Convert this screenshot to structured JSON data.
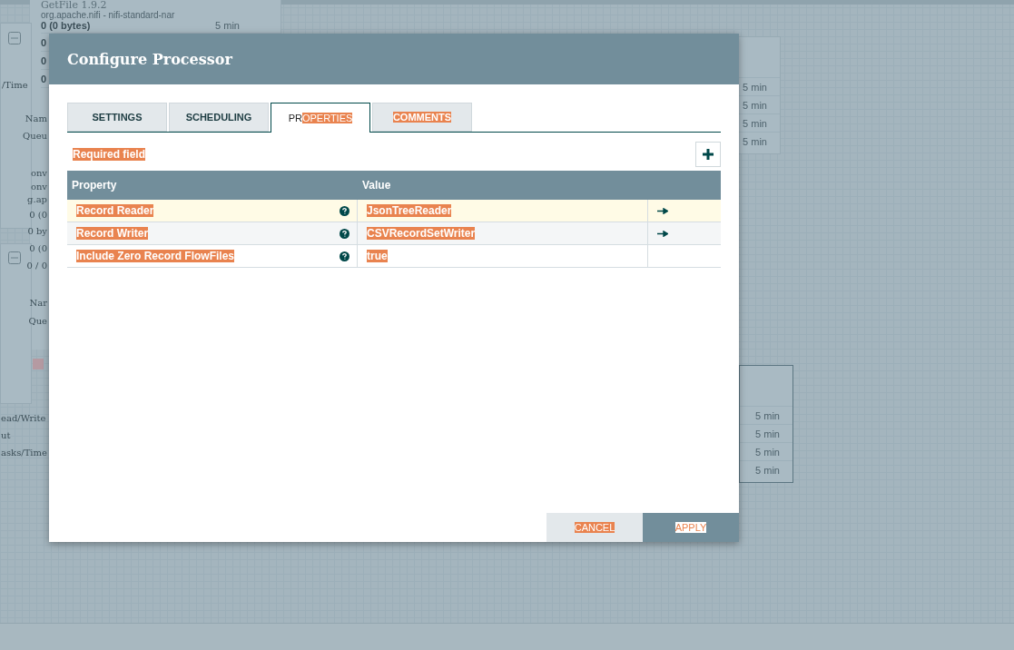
{
  "canvas": {
    "left_card": {
      "title": "GetFile 1.9.2",
      "bundle": "org.apache.nifi - nifi-standard-nar",
      "stats": [
        {
          "value": "0 (0 bytes)",
          "time": "5 min"
        },
        {
          "value": "0"
        },
        {
          "value": "0"
        },
        {
          "value": "0"
        }
      ]
    },
    "fragments": [
      "/Time",
      "Nam",
      "Queu",
      "onv",
      "onv",
      "g.ap",
      "0 (0",
      "0 by",
      "0 (0",
      "0 / 0",
      "Nar",
      "Que",
      "ead/Write",
      "ut",
      "asks/Time"
    ],
    "right_cards": [
      {
        "selected": false,
        "times": [
          "5 min",
          "5 min",
          "5 min",
          "5 min"
        ]
      },
      {
        "selected": true,
        "times": [
          "5 min",
          "5 min",
          "5 min",
          "5 min"
        ]
      }
    ]
  },
  "dialog": {
    "title": "Configure Processor",
    "tabs": [
      {
        "selected": false,
        "label": [
          {
            "text": "SETTINGS",
            "highlighted": false
          }
        ]
      },
      {
        "selected": false,
        "label": [
          {
            "text": "SCHEDULING",
            "highlighted": false
          }
        ]
      },
      {
        "selected": true,
        "label": [
          {
            "text": "PR",
            "highlighted": false
          },
          {
            "text": "OPERTIES",
            "highlighted": true
          }
        ]
      },
      {
        "selected": false,
        "label": [
          {
            "text": "COMMENTS",
            "highlighted": true
          }
        ]
      }
    ],
    "required_note": {
      "text": "Required field",
      "highlighted": true
    },
    "table": {
      "columns": [
        "Property",
        "Value"
      ],
      "rows": [
        {
          "property": "Record Reader",
          "value": "JsonTreeReader",
          "selected": true,
          "highlighted": true,
          "go_to": true
        },
        {
          "property": "Record Writer",
          "value": "CSVRecordSetWriter",
          "selected": false,
          "highlighted": true,
          "go_to": true
        },
        {
          "property": "Include Zero Record FlowFiles",
          "value": "true",
          "selected": false,
          "highlighted": true,
          "go_to": false
        }
      ]
    },
    "buttons": [
      {
        "kind": "secondary",
        "label": "CANCEL",
        "highlighted": true
      },
      {
        "kind": "primary",
        "label": "APPLY",
        "highlighted": true
      }
    ]
  }
}
